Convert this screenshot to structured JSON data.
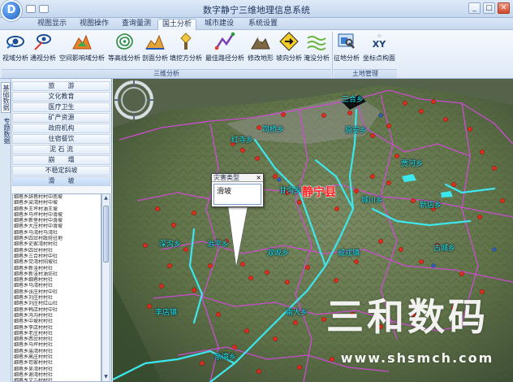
{
  "window": {
    "title": "数字静宁三维地理信息系统",
    "logo_letter": "D",
    "controls": [
      "_",
      "□",
      "✕"
    ]
  },
  "menu": {
    "tabs": [
      {
        "label": "视图显示"
      },
      {
        "label": "视图操作"
      },
      {
        "label": "查询量测"
      },
      {
        "label": "国土分析"
      },
      {
        "label": "城市建设"
      },
      {
        "label": "系统设置"
      }
    ]
  },
  "ribbon": {
    "tools": [
      {
        "label": "视域分析",
        "icon": "viewshed-icon"
      },
      {
        "label": "通视分析",
        "icon": "line-of-sight-icon"
      },
      {
        "label": "空间影响域分析",
        "icon": "influence-area-icon"
      },
      {
        "label": "等高线分析",
        "icon": "contour-icon"
      },
      {
        "label": "剖面分析",
        "icon": "profile-icon"
      },
      {
        "label": "填挖方分析",
        "icon": "cut-fill-icon"
      },
      {
        "label": "最佳路径分析",
        "icon": "best-path-icon"
      },
      {
        "label": "修改地形",
        "icon": "modify-terrain-icon"
      },
      {
        "label": "坡向分析",
        "icon": "aspect-icon"
      },
      {
        "label": "淹没分析",
        "icon": "flood-icon"
      },
      {
        "label": "征地分析",
        "icon": "land-acquisition-icon"
      },
      {
        "label": "坐标点构面",
        "icon": "xy-polygon-icon"
      }
    ],
    "groups": [
      {
        "label": "三维分析"
      },
      {
        "label": "土地管理"
      }
    ],
    "xy_text": "XY"
  },
  "left": {
    "vtabs": [
      {
        "label": "基础数据"
      },
      {
        "label": "专题数据"
      }
    ],
    "categories": [
      "旅　　游",
      "文化教育",
      "医疗卫生",
      "矿产资源",
      "政府机构",
      "住宿餐饮",
      "泥 石 流",
      "崩　　塌",
      "不稳定斜坡",
      "滑　　坡"
    ],
    "list": [
      "细巷乡辞巷村村中南坡",
      "细巷乡梁湾村村中坡",
      "细巷乡王坪村油王坡",
      "细巷乡马坪村村中滑坡",
      "细巷乡新堡村村中滑坡",
      "细巷乡大庄村村中滑坡",
      "细巷乡马湾村马湾社",
      "细巷乡四岔村政府驻地",
      "细巷乡史家湾村村社",
      "细巷乡四岔村村社",
      "细巷乡三合村村中社",
      "细巷乡党湾村阳坡社",
      "细巷乡新洼村村社",
      "细巷乡新洼村油坊社",
      "细巷乡细巷村村社",
      "细巷乡马湾村村社",
      "细巷乡张庄村村中社",
      "细巷乡刘庄村村社",
      "细巷乡刘庄村红山社",
      "细巷乡韩店村村中社",
      "细巷乡冯沟村村社",
      "细巷乡中坡村村社",
      "细巷乡李店村村社",
      "细巷乡老庄村村社",
      "细巷乡西岔村村社",
      "细巷乡马坪村村社",
      "细巷乡庙湾村村社",
      "细巷乡高庄村村社",
      "细巷乡苟家村村社",
      "细巷乡吴湾村村社",
      "细巷乡谢湾村村社",
      "细巷乡文屲村村社"
    ]
  },
  "map": {
    "places": [
      {
        "name": "静宁县",
        "big": true
      },
      {
        "name": "深沟乡"
      },
      {
        "name": "治平乡"
      },
      {
        "name": "双岘乡"
      },
      {
        "name": "威戎镇"
      },
      {
        "name": "古城乡"
      },
      {
        "name": "李店镇"
      },
      {
        "name": "雷大乡"
      },
      {
        "name": "余湾乡"
      },
      {
        "name": "城川乡"
      },
      {
        "name": "甘沟乡"
      },
      {
        "name": "红寺乡"
      },
      {
        "name": "司桥乡"
      },
      {
        "name": "原安乡"
      },
      {
        "name": "贾河乡"
      },
      {
        "name": "新店乡"
      },
      {
        "name": "三合乡"
      }
    ],
    "popup": {
      "title": "灾害类型",
      "close": "×",
      "content": "滑坡"
    }
  },
  "watermark": {
    "text": "三和数码",
    "url": "www.shsmch.com"
  },
  "colors": {
    "river": "#3ce7ee",
    "boundary": "#d24bd8",
    "marker": "#e62a1c",
    "terrain": "#5c7048"
  }
}
